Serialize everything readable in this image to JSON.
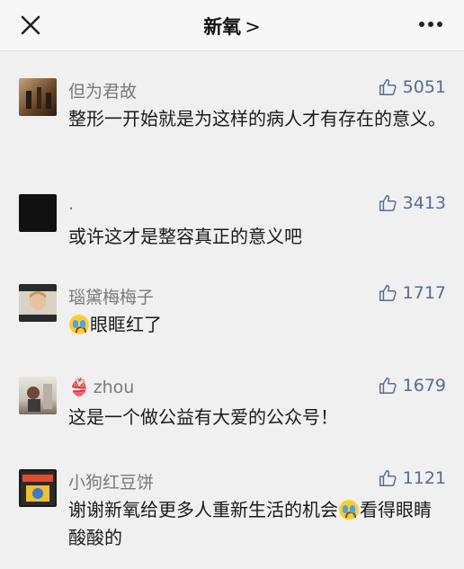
{
  "header": {
    "title": "新氧",
    "chevron": ">",
    "close_icon": "close-icon",
    "more_icon": "more-icon"
  },
  "comments": [
    {
      "name": "但为君故",
      "likes": "5051",
      "text": "整形一开始就是为这样的病人才有存在的意义。",
      "emoji": ""
    },
    {
      "name": ".",
      "likes": "3413",
      "text": "或许这才是整容真正的意义吧",
      "emoji": ""
    },
    {
      "name": "瑙黛梅梅子",
      "likes": "1717",
      "text": "眼眶红了",
      "emoji": "crying-face-icon"
    },
    {
      "name": "zhou",
      "name_prefix": "👙",
      "likes": "1679",
      "text": "这是一个做公益有大爱的公众号！",
      "emoji": ""
    },
    {
      "name": "小狗红豆饼",
      "likes": "1121",
      "text_before": "谢谢新氧给更多人重新生活的机会",
      "text_after": "看得眼睛酸酸的",
      "emoji": "crying-face-icon"
    }
  ],
  "colors": {
    "like_blue": "#576b95",
    "name_gray": "#7a7a7a",
    "background": "#f0f0f0"
  }
}
